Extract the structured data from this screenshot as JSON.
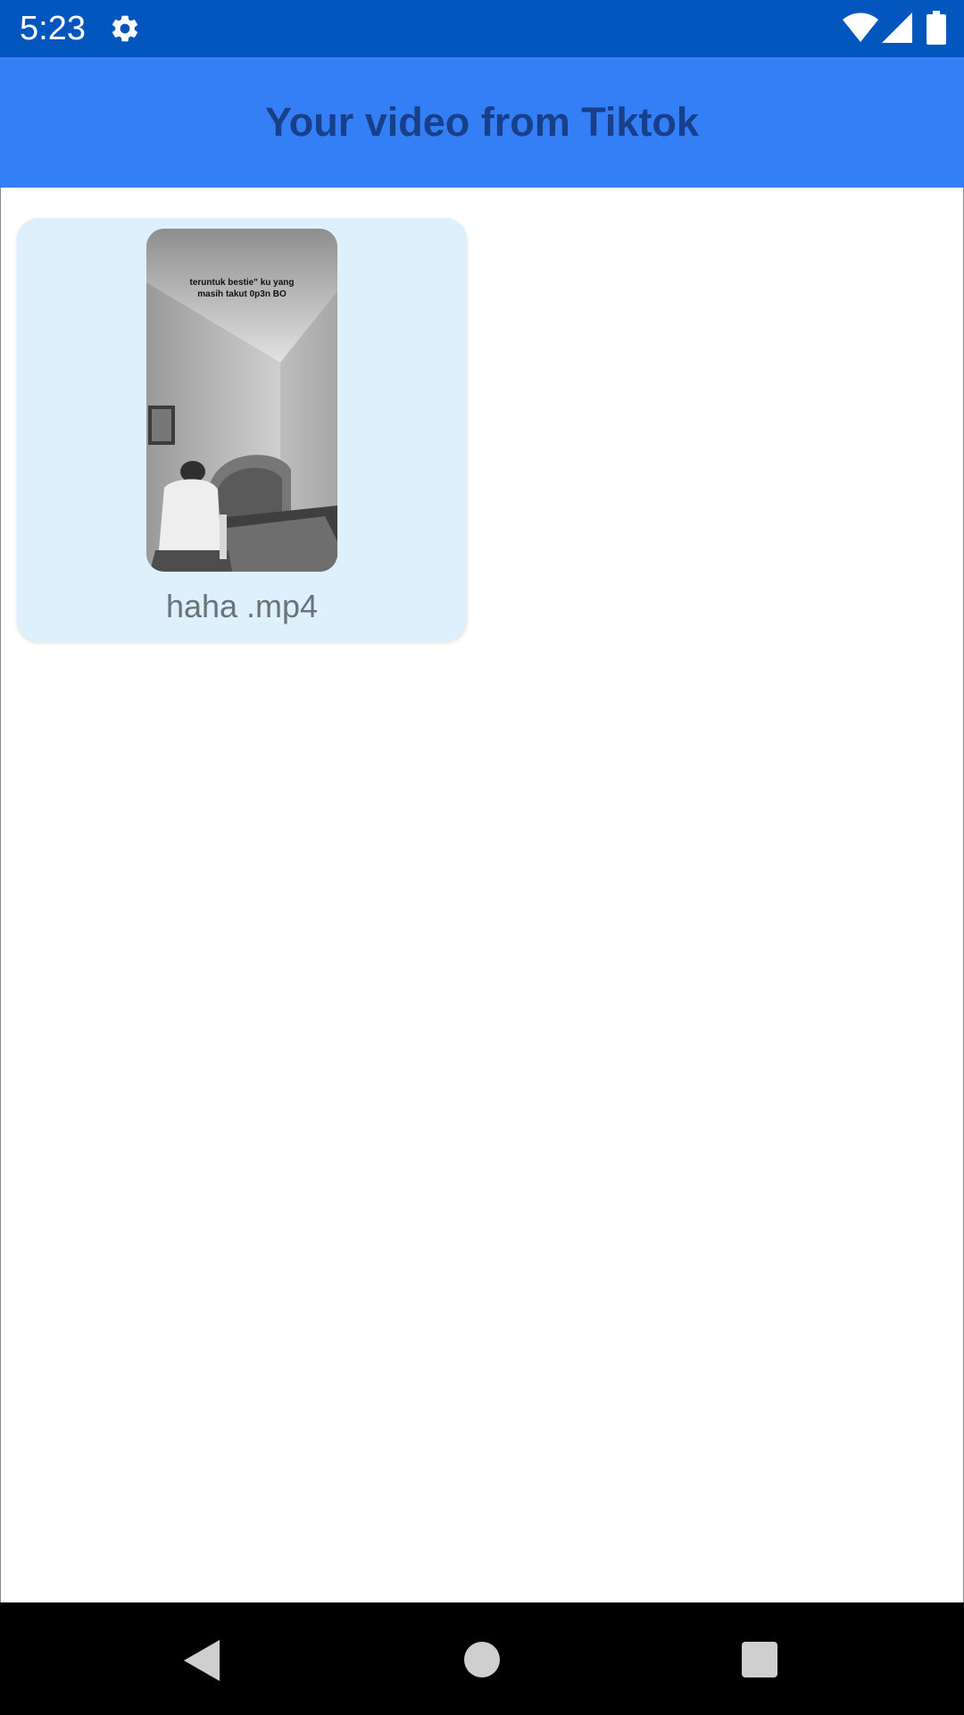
{
  "status_bar": {
    "time": "5:23",
    "icons": [
      "gear-icon",
      "wifi-icon",
      "signal-icon",
      "battery-icon"
    ],
    "background": "#0256bd"
  },
  "app_bar": {
    "title": "Your video from Tiktok",
    "background": "#347ff5",
    "title_color": "#173f8a"
  },
  "videos": [
    {
      "thumbnail_caption_line1": "teruntuk bestie\" ku yang",
      "thumbnail_caption_line2": "masih takut 0p3n BO",
      "file_name": "haha .mp4",
      "card_background": "#dff0fd"
    }
  ],
  "nav_bar": {
    "icons": [
      "back-icon",
      "home-icon",
      "recents-icon"
    ]
  }
}
